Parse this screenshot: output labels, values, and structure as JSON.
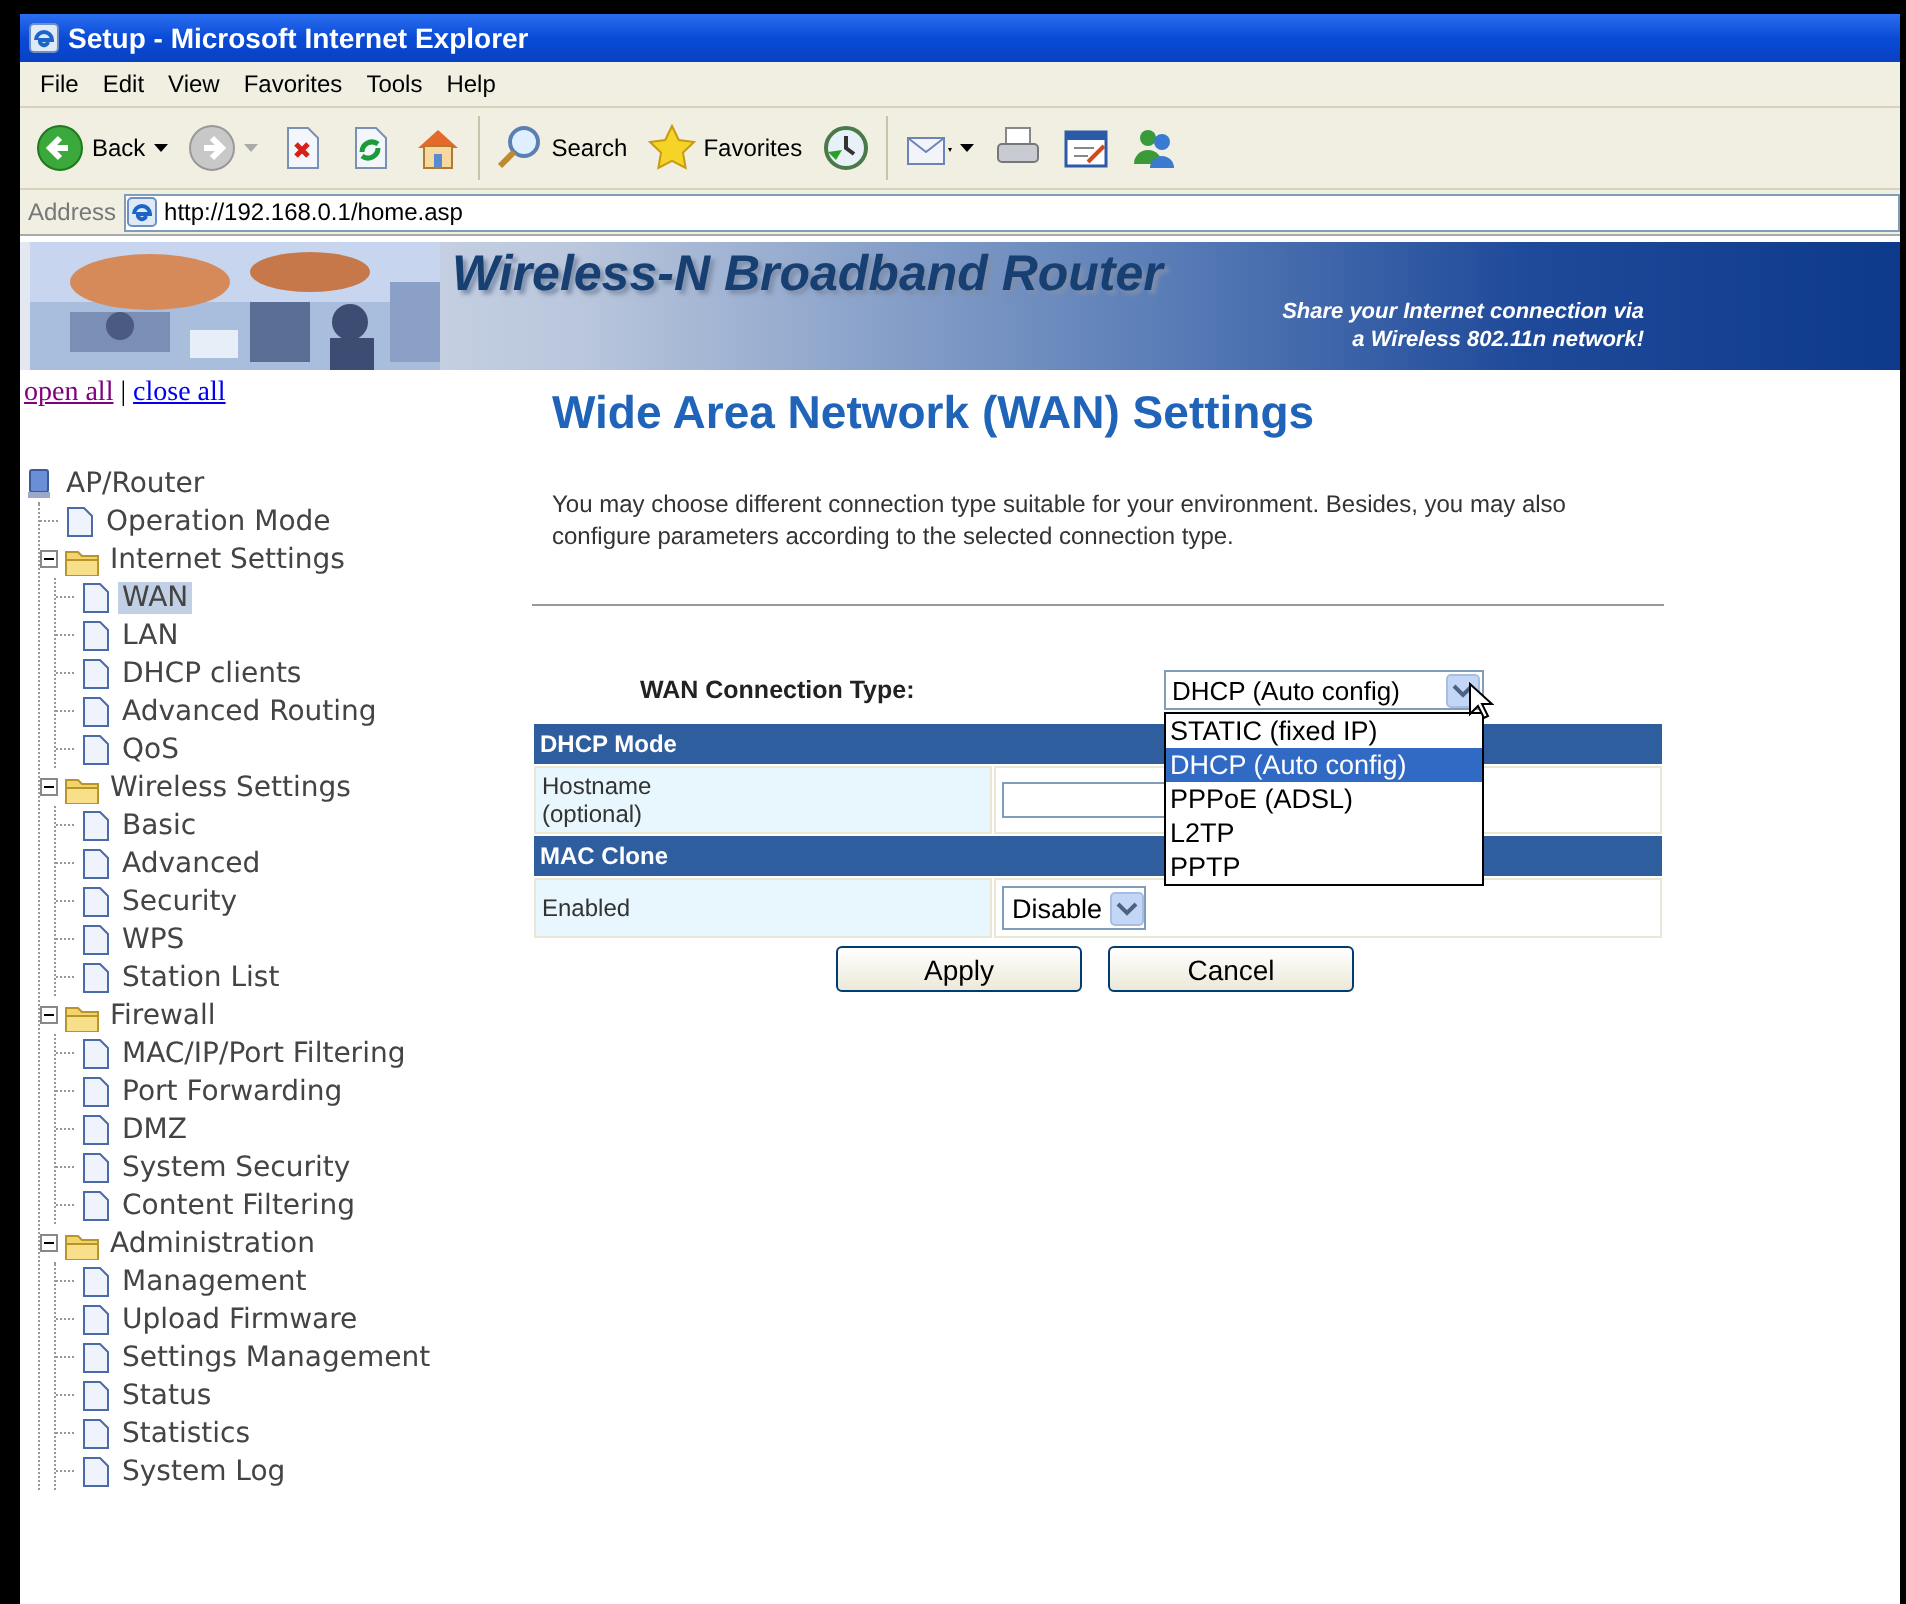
{
  "window": {
    "title": "Setup - Microsoft Internet Explorer"
  },
  "menu": [
    "File",
    "Edit",
    "View",
    "Favorites",
    "Tools",
    "Help"
  ],
  "toolbar": [
    {
      "kind": "back",
      "label": "Back"
    },
    {
      "kind": "forward"
    },
    {
      "kind": "stop"
    },
    {
      "kind": "refresh"
    },
    {
      "kind": "home"
    },
    {
      "kind": "search",
      "label": "Search"
    },
    {
      "kind": "favorites",
      "label": "Favorites"
    },
    {
      "kind": "history"
    },
    {
      "kind": "mail"
    },
    {
      "kind": "print"
    },
    {
      "kind": "edit"
    },
    {
      "kind": "messenger"
    }
  ],
  "address": {
    "label": "Address",
    "value": "http://192.168.0.1/home.asp"
  },
  "banner": {
    "title": "Wireless-N Broadband Router",
    "tagline": [
      "Share your Internet connection via",
      "a Wireless 802.11n network!"
    ]
  },
  "nav": {
    "link_separator": "|",
    "links": [
      {
        "label": "open all",
        "visited": true
      },
      {
        "label": "close all",
        "visited": false
      }
    ],
    "tree": {
      "label": "AP/Router",
      "kind": "device",
      "children": [
        {
          "label": "Operation Mode",
          "kind": "page",
          "selected": false
        },
        {
          "label": "Internet Settings",
          "kind": "folder",
          "expanded": true,
          "children": [
            {
              "label": "WAN",
              "kind": "page",
              "selected": true
            },
            {
              "label": "LAN",
              "kind": "page",
              "selected": false
            },
            {
              "label": "DHCP clients",
              "kind": "page",
              "selected": false
            },
            {
              "label": "Advanced Routing",
              "kind": "page",
              "selected": false
            },
            {
              "label": "QoS",
              "kind": "page",
              "selected": false
            }
          ]
        },
        {
          "label": "Wireless Settings",
          "kind": "folder",
          "expanded": true,
          "children": [
            {
              "label": "Basic",
              "kind": "page",
              "selected": false
            },
            {
              "label": "Advanced",
              "kind": "page",
              "selected": false
            },
            {
              "label": "Security",
              "kind": "page",
              "selected": false
            },
            {
              "label": "WPS",
              "kind": "page",
              "selected": false
            },
            {
              "label": "Station List",
              "kind": "page",
              "selected": false
            }
          ]
        },
        {
          "label": "Firewall",
          "kind": "folder",
          "expanded": true,
          "children": [
            {
              "label": "MAC/IP/Port Filtering",
              "kind": "page",
              "selected": false
            },
            {
              "label": "Port Forwarding",
              "kind": "page",
              "selected": false
            },
            {
              "label": "DMZ",
              "kind": "page",
              "selected": false
            },
            {
              "label": "System Security",
              "kind": "page",
              "selected": false
            },
            {
              "label": "Content Filtering",
              "kind": "page",
              "selected": false
            }
          ]
        },
        {
          "label": "Administration",
          "kind": "folder",
          "expanded": true,
          "children": [
            {
              "label": "Management",
              "kind": "page",
              "selected": false
            },
            {
              "label": "Upload Firmware",
              "kind": "page",
              "selected": false
            },
            {
              "label": "Settings Management",
              "kind": "page",
              "selected": false
            },
            {
              "label": "Status",
              "kind": "page",
              "selected": false
            },
            {
              "label": "Statistics",
              "kind": "page",
              "selected": false
            },
            {
              "label": "System Log",
              "kind": "page",
              "selected": false
            }
          ]
        }
      ]
    }
  },
  "page": {
    "title": "Wide Area Network (WAN) Settings",
    "intro": "You may choose different connection type suitable for your environment. Besides, you may also configure parameters according to the selected connection type.",
    "connection_type": {
      "label": "WAN Connection Type:",
      "value": "DHCP (Auto config)",
      "open": true,
      "options": [
        {
          "label": "STATIC (fixed IP)",
          "selected": false
        },
        {
          "label": "DHCP (Auto config)",
          "selected": true
        },
        {
          "label": "PPPoE (ADSL)",
          "selected": false
        },
        {
          "label": "L2TP",
          "selected": false
        },
        {
          "label": "PPTP",
          "selected": false
        }
      ]
    },
    "sections": [
      {
        "title": "DHCP Mode",
        "rows": [
          {
            "label_lines": [
              "Hostname",
              "(optional)"
            ],
            "kind": "text"
          }
        ]
      },
      {
        "title": "MAC Clone",
        "rows": [
          {
            "label_lines": [
              "Enabled"
            ],
            "kind": "select",
            "value": "Disable"
          }
        ]
      }
    ],
    "buttons": [
      "Apply",
      "Cancel"
    ]
  }
}
